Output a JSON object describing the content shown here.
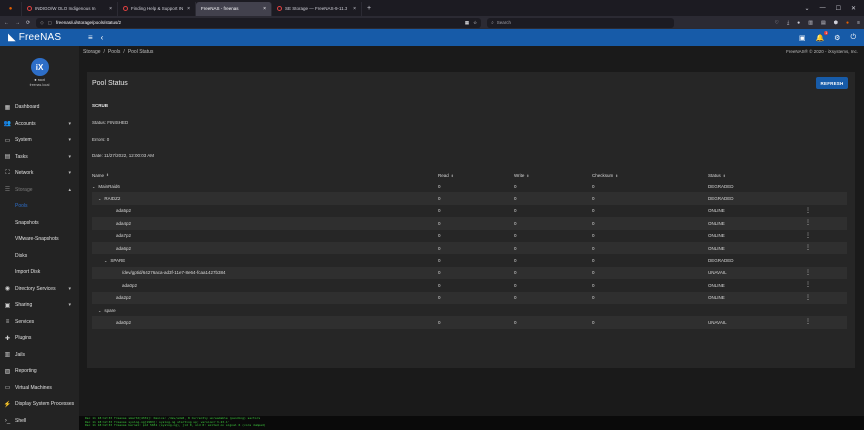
{
  "browser": {
    "tabs": [
      {
        "label": "INDIGO/W OLO Indigenous In",
        "active": false
      },
      {
        "label": "Finding Help & Support IND",
        "active": false
      },
      {
        "label": "FreeNAS - freenas",
        "active": true
      },
      {
        "label": "SE Storage — FreeNAS-9-11.3",
        "active": false
      }
    ],
    "new_tab": "+",
    "window_controls": [
      "⌄",
      "—",
      "☐",
      "✕"
    ],
    "url": "freenas/ui/storage/pools/status/2",
    "search_placeholder": "Search"
  },
  "app": {
    "logo_text": "FreeNAS",
    "notification_count": "1",
    "brand_color": "#175ba8"
  },
  "sidebar": {
    "profile": {
      "avatar": "iX",
      "user": "● root",
      "host": "freenas.local"
    },
    "items": [
      {
        "label": "Dashboard",
        "icon": "dashboard-icon",
        "glyph": "▦",
        "chevron": ""
      },
      {
        "label": "Accounts",
        "icon": "accounts-icon",
        "glyph": "👥",
        "chevron": "▾"
      },
      {
        "label": "System",
        "icon": "system-icon",
        "glyph": "▭",
        "chevron": "▾"
      },
      {
        "label": "Tasks",
        "icon": "tasks-icon",
        "glyph": "▤",
        "chevron": "▾"
      },
      {
        "label": "Network",
        "icon": "network-icon",
        "glyph": "⛶",
        "chevron": "▾"
      },
      {
        "label": "Storage",
        "icon": "storage-icon",
        "glyph": "☰",
        "chevron": "▴",
        "dim": true
      },
      {
        "label": "Pools",
        "sub": true,
        "activesub": true
      },
      {
        "label": "Snapshots",
        "sub": true
      },
      {
        "label": "VMware-Snapshots",
        "sub": true
      },
      {
        "label": "Disks",
        "sub": true
      },
      {
        "label": "Import Disk",
        "sub": true
      },
      {
        "label": "Directory Services",
        "icon": "directory-services-icon",
        "glyph": "◉",
        "chevron": "▾"
      },
      {
        "label": "Sharing",
        "icon": "sharing-icon",
        "glyph": "▣",
        "chevron": "▾"
      },
      {
        "label": "Services",
        "icon": "services-icon",
        "glyph": "≡",
        "chevron": ""
      },
      {
        "label": "Plugins",
        "icon": "plugins-icon",
        "glyph": "✚",
        "chevron": ""
      },
      {
        "label": "Jails",
        "icon": "jails-icon",
        "glyph": "▥",
        "chevron": ""
      },
      {
        "label": "Reporting",
        "icon": "reporting-icon",
        "glyph": "▨",
        "chevron": ""
      },
      {
        "label": "Virtual Machines",
        "icon": "virtual-machines-icon",
        "glyph": "▭",
        "chevron": ""
      },
      {
        "label": "Display System Processes",
        "icon": "processes-icon",
        "glyph": "⚡",
        "chevron": ""
      },
      {
        "label": "Shell",
        "icon": "shell-icon",
        "glyph": "›_",
        "chevron": ""
      }
    ]
  },
  "breadcrumbs": [
    "Storage",
    "Pools",
    "Pool Status"
  ],
  "copyright": "FreeNAS® © 2020 - iXsystems, Inc.",
  "pool_status": {
    "title": "Pool Status",
    "refresh_label": "REFRESH",
    "scrub_heading": "SCRUB",
    "status_line": "Status: FINISHED",
    "errors_line": "Errors: 0",
    "date_line": "Date: 11/27/2022, 12:00:03 AM"
  },
  "table": {
    "headers": {
      "name": "Name",
      "read": "Read",
      "write": "Write",
      "checksum": "Checksum",
      "status": "Status"
    },
    "rows": [
      {
        "name": "MainRaid6",
        "indent": 0,
        "caret": "⌄",
        "read": "0",
        "write": "0",
        "checksum": "0",
        "status": "DEGRADED",
        "alt": false,
        "kebab": false
      },
      {
        "name": "RAIDZ2",
        "indent": 1,
        "caret": "⌄",
        "read": "0",
        "write": "0",
        "checksum": "0",
        "status": "DEGRADED",
        "alt": true,
        "kebab": false
      },
      {
        "name": "ada5p2",
        "indent": 2,
        "caret": "",
        "read": "0",
        "write": "0",
        "checksum": "0",
        "status": "ONLINE",
        "alt": false,
        "kebab": true
      },
      {
        "name": "ada4p2",
        "indent": 2,
        "caret": "",
        "read": "0",
        "write": "0",
        "checksum": "0",
        "status": "ONLINE",
        "alt": true,
        "kebab": true
      },
      {
        "name": "ada7p2",
        "indent": 2,
        "caret": "",
        "read": "0",
        "write": "0",
        "checksum": "0",
        "status": "ONLINE",
        "alt": false,
        "kebab": true
      },
      {
        "name": "ada6p2",
        "indent": 2,
        "caret": "",
        "read": "0",
        "write": "0",
        "checksum": "0",
        "status": "ONLINE",
        "alt": true,
        "kebab": true
      },
      {
        "name": "SPARE",
        "indent": 2,
        "caret": "⌄",
        "read": "0",
        "write": "0",
        "checksum": "0",
        "status": "DEGRADED",
        "alt": false,
        "kebab": false
      },
      {
        "name": "/dev/gptid/64276aca-ad3f-11e7-8e64-fcaa1427b384",
        "indent": 3,
        "caret": "",
        "read": "0",
        "write": "0",
        "checksum": "0",
        "status": "UNAVAIL",
        "alt": true,
        "kebab": true
      },
      {
        "name": "ada0p2",
        "indent": 3,
        "caret": "",
        "read": "0",
        "write": "0",
        "checksum": "0",
        "status": "ONLINE",
        "alt": false,
        "kebab": true
      },
      {
        "name": "ada2p2",
        "indent": 2,
        "caret": "",
        "read": "0",
        "write": "0",
        "checksum": "0",
        "status": "ONLINE",
        "alt": true,
        "kebab": true
      },
      {
        "name": "spare",
        "indent": 1,
        "caret": "⌄",
        "read": "",
        "write": "",
        "checksum": "",
        "status": "",
        "alt": false,
        "kebab": false
      },
      {
        "name": "ada0p2",
        "indent": 2,
        "caret": "",
        "read": "0",
        "write": "0",
        "checksum": "0",
        "status": "UNAVAIL",
        "alt": true,
        "kebab": true
      }
    ]
  },
  "shell_lines": [
    "Dec 11 18:12:33 freenas smartd[4331]: Device: /dev/ada5, 8 Currently unreadable (pending) sectors",
    "Dec 11 18:12:33 freenas syslog-ng[1983]: syslog-ng starting up; version='3.23.1'",
    "Dec 11 18:12:33 freenas kernel: pid 5651 (syslog-ng), jid 0, uid 0: exited on signal 6 (core dumped)"
  ]
}
